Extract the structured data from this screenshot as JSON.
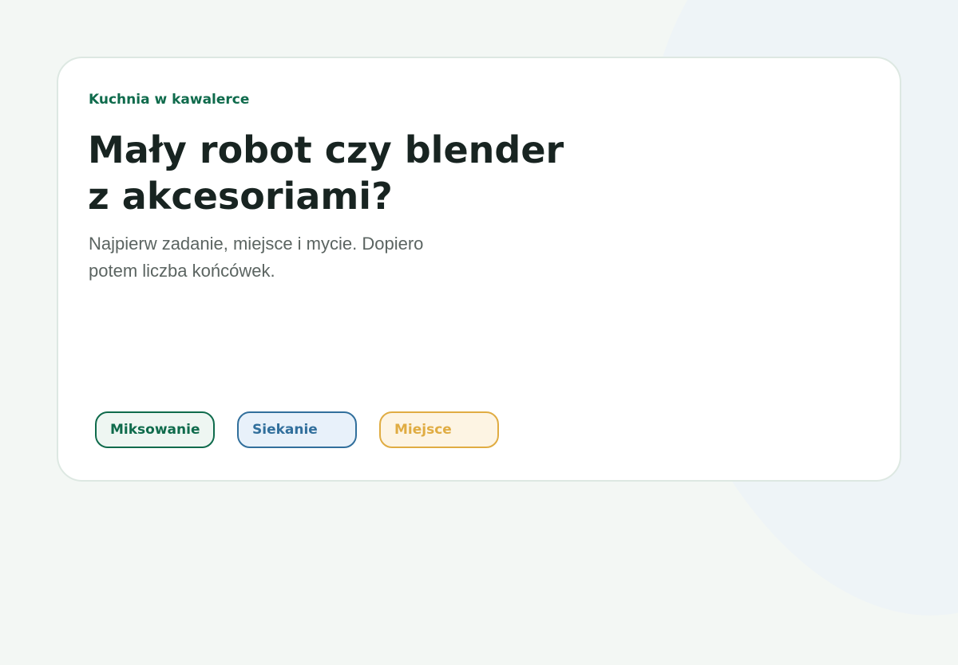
{
  "header": {
    "eyebrow": "Kuchnia w kawalerce",
    "title_line1": "Mały robot czy blender",
    "title_line2": "z akcesoriami?",
    "subtitle_line1": "Najpierw zadanie, miejsce i mycie. Dopiero",
    "subtitle_line2": "potem liczba końcówek."
  },
  "tags": [
    {
      "label": "Miksowanie",
      "color": "#0f6b4c"
    },
    {
      "label": "Siekanie",
      "color": "#316f9c"
    },
    {
      "label": "Miejsce",
      "color": "#e0ac42"
    }
  ],
  "illustration": {
    "blender_color": "#0f6b4c",
    "processor_color": "#316f9c",
    "shelf_color": "#e0ac42"
  }
}
